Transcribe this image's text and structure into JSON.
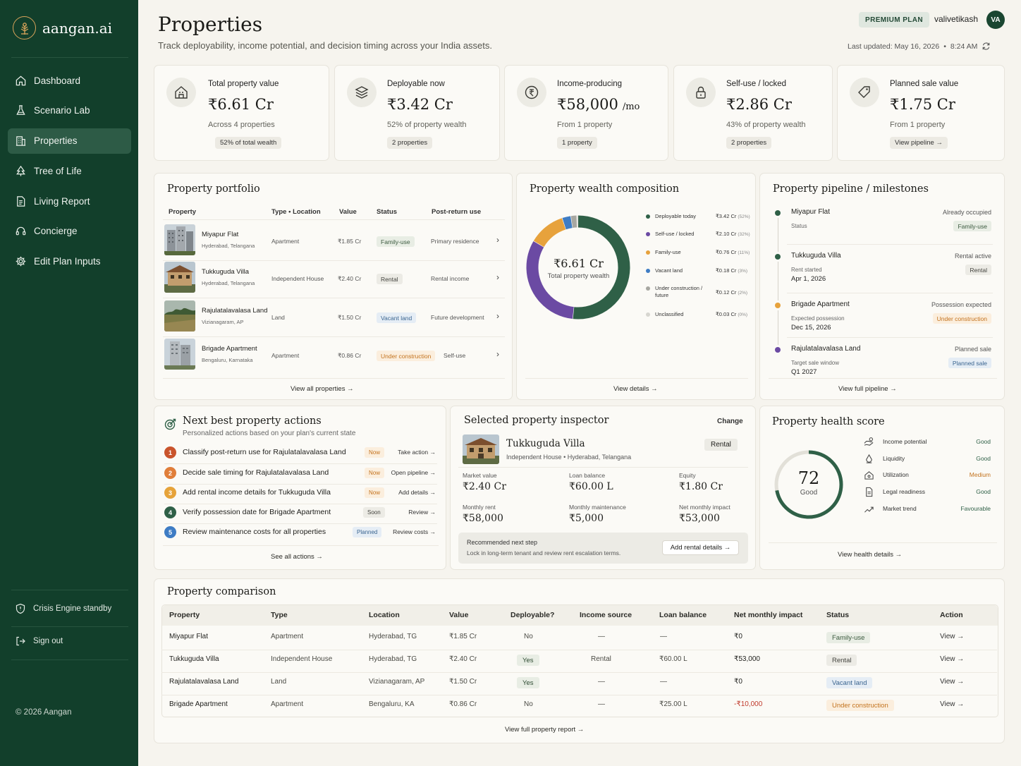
{
  "app": {
    "name": "aangan.ai",
    "copyright": "© 2026 Aangan"
  },
  "sidebar": {
    "items": [
      {
        "label": "Dashboard",
        "icon": "home-icon"
      },
      {
        "label": "Scenario Lab",
        "icon": "flask-icon"
      },
      {
        "label": "Properties",
        "icon": "building-icon",
        "active": true
      },
      {
        "label": "Tree of Life",
        "icon": "tree-icon"
      },
      {
        "label": "Living Report",
        "icon": "report-icon"
      },
      {
        "label": "Concierge",
        "icon": "headset-icon"
      },
      {
        "label": "Edit Plan Inputs",
        "icon": "gear-icon"
      }
    ],
    "crisis_label": "Crisis Engine standby",
    "signout_label": "Sign out"
  },
  "header": {
    "title": "Properties",
    "subtitle": "Track deployability, income potential, and decision timing across your India assets.",
    "plan_badge": "PREMIUM PLAN",
    "user_name": "valivetikash",
    "avatar_initials": "VA",
    "last_updated": "Last updated: May 16, 2026",
    "time": "8:24 AM"
  },
  "kpis": [
    {
      "label": "Total property value",
      "value": "₹6.61 Cr",
      "unit": "",
      "sub": "Across 4 properties",
      "chip": "52% of total wealth",
      "icon": "house-icon"
    },
    {
      "label": "Deployable now",
      "value": "₹3.42 Cr",
      "unit": "",
      "sub": "52% of property wealth",
      "chip": "2 properties",
      "icon": "layers-icon"
    },
    {
      "label": "Income-producing",
      "value": "₹58,000",
      "unit": "/mo",
      "sub": "From 1 property",
      "chip": "1 property",
      "icon": "rupee-icon"
    },
    {
      "label": "Self-use / locked",
      "value": "₹2.86 Cr",
      "unit": "",
      "sub": "43% of property wealth",
      "chip": "2 properties",
      "icon": "lock-icon"
    },
    {
      "label": "Planned sale value",
      "value": "₹1.75 Cr",
      "unit": "",
      "sub": "From 1 property",
      "chip": "View pipeline →",
      "icon": "tag-icon"
    }
  ],
  "portfolio": {
    "title": "Property portfolio",
    "headers": [
      "Property",
      "Type • Location",
      "Value",
      "Status",
      "Post-return use"
    ],
    "rows": [
      {
        "name": "Miyapur Flat",
        "location": "Hyderabad, Telangana",
        "type": "Apartment",
        "value": "₹1.85 Cr",
        "status": "Family-use",
        "status_color": "green",
        "use": "Primary residence"
      },
      {
        "name": "Tukkuguda Villa",
        "location": "Hyderabad, Telangana",
        "type": "Independent House",
        "value": "₹2.40 Cr",
        "status": "Rental",
        "status_color": "gray",
        "use": "Rental income"
      },
      {
        "name": "Rajulatalavalasa Land",
        "location": "Vizianagaram, AP",
        "type": "Land",
        "value": "₹1.50 Cr",
        "status": "Vacant land",
        "status_color": "blue",
        "use": "Future development"
      },
      {
        "name": "Brigade Apartment",
        "location": "Bengaluru, Karnataka",
        "type": "Apartment",
        "value": "₹0.86 Cr",
        "status": "Under construction",
        "status_color": "orange",
        "use": "Self-use"
      }
    ],
    "link": "View all properties →"
  },
  "composition": {
    "title": "Property wealth composition",
    "center_value": "₹6.61 Cr",
    "center_label": "Total property wealth",
    "link": "View details →"
  },
  "chart_data": {
    "type": "pie",
    "title": "Property wealth composition",
    "categories": [
      "Deployable today",
      "Self-use / locked",
      "Family-use",
      "Vacant land",
      "Under construction / future",
      "Unclassified"
    ],
    "values": [
      3.42,
      2.1,
      0.76,
      0.18,
      0.12,
      0.03
    ],
    "value_labels": [
      "₹3.42 Cr",
      "₹2.10 Cr",
      "₹0.76 Cr",
      "₹0.18 Cr",
      "₹0.12 Cr",
      "₹0.03 Cr"
    ],
    "percent_labels": [
      "(52%)",
      "(32%)",
      "(11%)",
      "(3%)",
      "(2%)",
      "(0%)"
    ],
    "colors": [
      "#2f6047",
      "#6b4aa3",
      "#e7a23c",
      "#3e7cc4",
      "#a7a7a1",
      "#d7d6d0"
    ],
    "legend": "right"
  },
  "pipeline": {
    "title": "Property pipeline / milestones",
    "items": [
      {
        "name": "Miyapur Flat",
        "state": "Already occupied",
        "detail_label": "Status",
        "detail_value": "",
        "pill": "Family-use",
        "pill_color": "green",
        "dot": "#2f6047"
      },
      {
        "name": "Tukkuguda Villa",
        "state": "Rental active",
        "detail_label": "Rent started",
        "detail_value": "Apr 1, 2026",
        "pill": "Rental",
        "pill_color": "gray",
        "dot": "#2f6047"
      },
      {
        "name": "Brigade Apartment",
        "state": "Possession expected",
        "detail_label": "Expected possession",
        "detail_value": "Dec 15, 2026",
        "pill": "Under construction",
        "pill_color": "orange",
        "dot": "#e7a23c"
      },
      {
        "name": "Rajulatalavalasa Land",
        "state": "Planned sale",
        "detail_label": "Target sale window",
        "detail_value": "Q1 2027",
        "pill": "Planned sale",
        "pill_color": "blue",
        "dot": "#6b4aa3"
      }
    ],
    "link": "View full pipeline →"
  },
  "actions": {
    "title": "Next best property actions",
    "subtitle": "Personalized actions based on your plan's current state",
    "items": [
      {
        "num": "1",
        "text": "Classify post-return use for Rajulatalavalasa Land",
        "tag": "Now",
        "tag_color": "orange",
        "cta": "Take action →",
        "color": "#c9542c"
      },
      {
        "num": "2",
        "text": "Decide sale timing for Rajulatalavalasa Land",
        "tag": "Now",
        "tag_color": "orange",
        "cta": "Open pipeline →",
        "color": "#e07e3a"
      },
      {
        "num": "3",
        "text": "Add rental income details for Tukkuguda Villa",
        "tag": "Now",
        "tag_color": "orange",
        "cta": "Add details →",
        "color": "#e6a33a"
      },
      {
        "num": "4",
        "text": "Verify possession date for Brigade Apartment",
        "tag": "Soon",
        "tag_color": "gray",
        "cta": "Review →",
        "color": "#2f6047"
      },
      {
        "num": "5",
        "text": "Review maintenance costs for all properties",
        "tag": "Planned",
        "tag_color": "blue",
        "cta": "Review costs →",
        "color": "#3e7cc4"
      }
    ],
    "link": "See all actions →"
  },
  "inspector": {
    "title": "Selected property inspector",
    "change": "Change",
    "name": "Tukkuguda Villa",
    "meta": "Independent House • Hyderabad, Telangana",
    "badge": "Rental",
    "metrics": [
      {
        "label": "Market value",
        "value": "₹2.40 Cr"
      },
      {
        "label": "Loan balance",
        "value": "₹60.00 L"
      },
      {
        "label": "Equity",
        "value": "₹1.80 Cr"
      },
      {
        "label": "Monthly rent",
        "value": "₹58,000"
      },
      {
        "label": "Monthly maintenance",
        "value": "₹5,000"
      },
      {
        "label": "Net monthly impact",
        "value": "₹53,000"
      }
    ],
    "rec_title": "Recommended next step",
    "rec_text": "Lock in long-term tenant and review rent escalation terms.",
    "rec_button": "Add rental details →"
  },
  "health": {
    "title": "Property health score",
    "score": "72",
    "score_value": 72,
    "score_label": "Good",
    "factors": [
      {
        "label": "Income potential",
        "value": "Good",
        "icon": "hand-coin-icon",
        "color": "#2f6047"
      },
      {
        "label": "Liquidity",
        "value": "Good",
        "icon": "drop-icon",
        "color": "#2f6047"
      },
      {
        "label": "Utilization",
        "value": "Medium",
        "icon": "house-gear-icon",
        "color": "#c3721d"
      },
      {
        "label": "Legal readiness",
        "value": "Good",
        "icon": "document-icon",
        "color": "#2f6047"
      },
      {
        "label": "Market trend",
        "value": "Favourable",
        "icon": "trend-up-icon",
        "color": "#2f6047"
      }
    ],
    "link": "View health details →"
  },
  "comparison": {
    "title": "Property comparison",
    "headers": [
      "Property",
      "Type",
      "Location",
      "Value",
      "Deployable?",
      "Income source",
      "Loan balance",
      "Net monthly impact",
      "Status",
      "Action"
    ],
    "rows": [
      {
        "property": "Miyapur Flat",
        "type": "Apartment",
        "location": "Hyderabad, TG",
        "value": "₹1.85 Cr",
        "deployable": "No",
        "deploy_pill": false,
        "income": "—",
        "loan": "—",
        "impact": "₹0",
        "impact_neg": false,
        "status": "Family-use",
        "status_color": "green",
        "action": "View →"
      },
      {
        "property": "Tukkuguda Villa",
        "type": "Independent House",
        "location": "Hyderabad, TG",
        "value": "₹2.40 Cr",
        "deployable": "Yes",
        "deploy_pill": true,
        "income": "Rental",
        "loan": "₹60.00 L",
        "impact": "₹53,000",
        "impact_neg": false,
        "status": "Rental",
        "status_color": "gray",
        "action": "View →"
      },
      {
        "property": "Rajulatalavalasa Land",
        "type": "Land",
        "location": "Vizianagaram, AP",
        "value": "₹1.50 Cr",
        "deployable": "Yes",
        "deploy_pill": true,
        "income": "—",
        "loan": "—",
        "impact": "₹0",
        "impact_neg": false,
        "status": "Vacant land",
        "status_color": "blue",
        "action": "View →"
      },
      {
        "property": "Brigade Apartment",
        "type": "Apartment",
        "location": "Bengaluru, KA",
        "value": "₹0.86 Cr",
        "deployable": "No",
        "deploy_pill": false,
        "income": "—",
        "loan": "₹25.00 L",
        "impact": "-₹10,000",
        "impact_neg": true,
        "status": "Under construction",
        "status_color": "orange",
        "action": "View →"
      }
    ],
    "link": "View full property report →"
  }
}
